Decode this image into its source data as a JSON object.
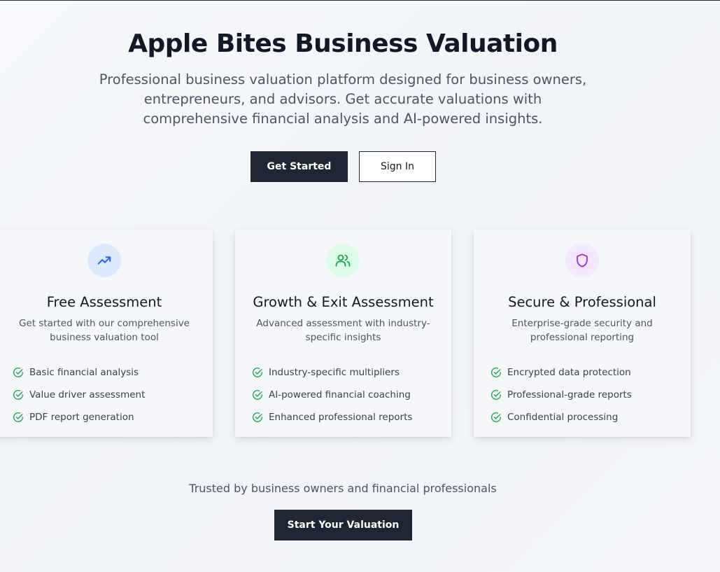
{
  "hero": {
    "title": "Apple Bites Business Valuation",
    "subtitle": "Professional business valuation platform designed for business owners, entrepreneurs, and advisors. Get accurate valuations with comprehensive financial analysis and AI-powered insights.",
    "get_started_label": "Get Started",
    "sign_in_label": "Sign In"
  },
  "cards": [
    {
      "icon": "trending-up-icon",
      "icon_color": "#2563eb",
      "icon_bg": "#dbeafe",
      "title": "Free Assessment",
      "description": "Get started with our comprehensive business valuation tool",
      "features": [
        "Basic financial analysis",
        "Value driver assessment",
        "PDF report generation"
      ]
    },
    {
      "icon": "users-icon",
      "icon_color": "#16a34a",
      "icon_bg": "#dcfce7",
      "title": "Growth & Exit Assessment",
      "description": "Advanced assessment with industry-specific insights",
      "features": [
        "Industry-specific multipliers",
        "AI-powered financial coaching",
        "Enhanced professional reports"
      ]
    },
    {
      "icon": "shield-icon",
      "icon_color": "#9333ea",
      "icon_bg": "#f3e8ff",
      "title": "Secure & Professional",
      "description": "Enterprise-grade security and professional reporting",
      "features": [
        "Encrypted data protection",
        "Professional-grade reports",
        "Confidential processing"
      ]
    }
  ],
  "footer": {
    "trusted_text": "Trusted by business owners and financial professionals",
    "cta_label": "Start Your Valuation"
  },
  "colors": {
    "primary_button": "#1e2533",
    "check": "#16a34a"
  }
}
